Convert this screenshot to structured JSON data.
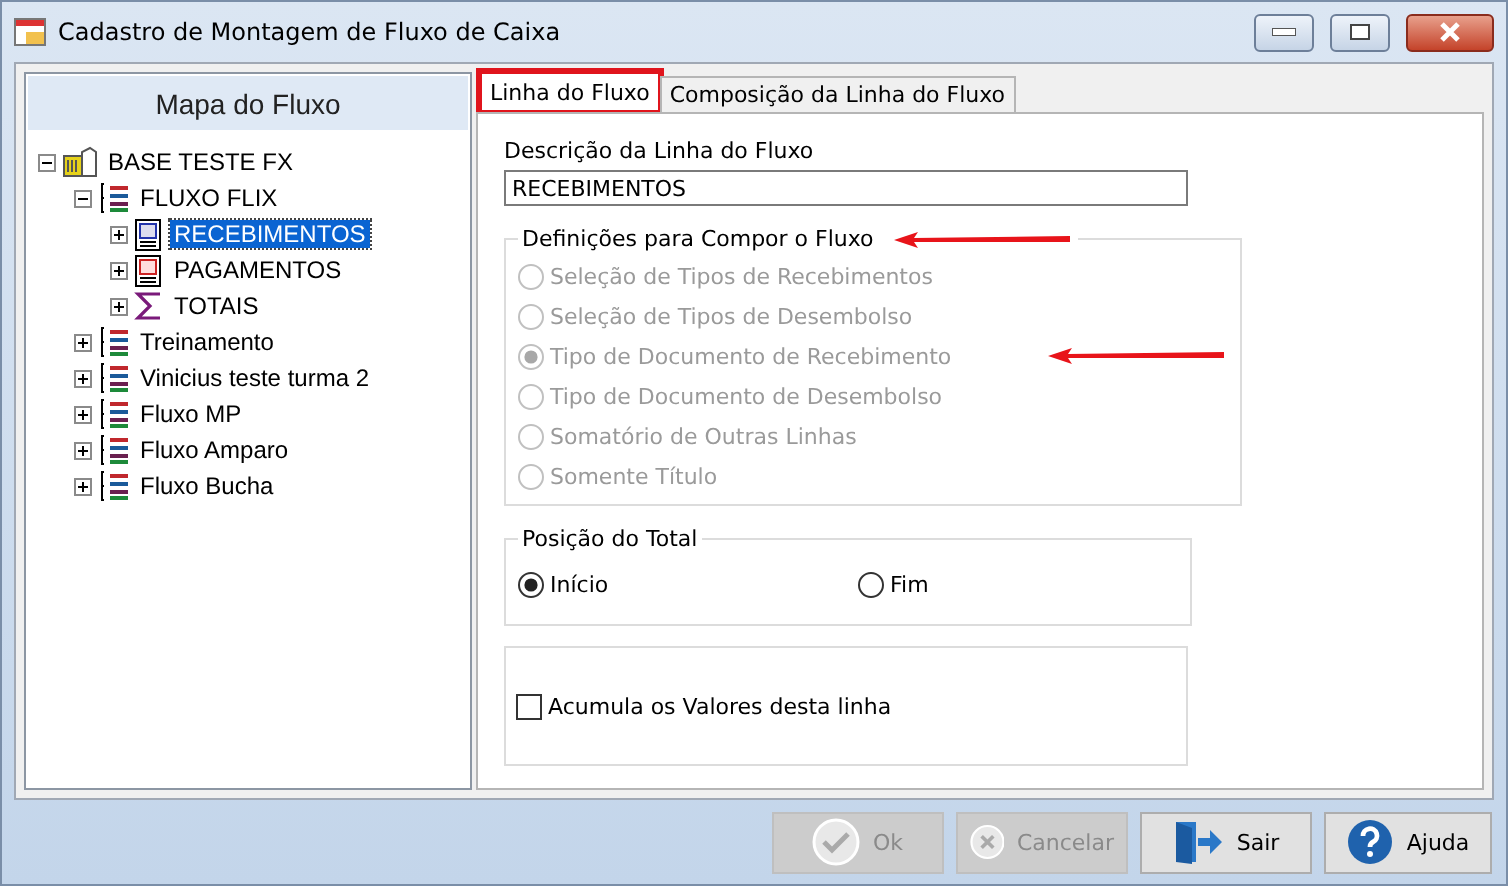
{
  "window": {
    "title": "Cadastro de Montagem de Fluxo de Caixa"
  },
  "tree_panel": {
    "title": "Mapa do Fluxo",
    "items": [
      {
        "label": "BASE TESTE FX",
        "kind": "building",
        "expanded": true,
        "selected": false,
        "children": [
          {
            "label": "FLUXO FLIX",
            "kind": "flow",
            "expanded": true,
            "selected": false,
            "children": [
              {
                "label": "RECEBIMENTOS",
                "kind": "doc-c",
                "expanded": false,
                "selected": true
              },
              {
                "label": "PAGAMENTOS",
                "kind": "doc-p",
                "expanded": false,
                "selected": false
              },
              {
                "label": "TOTAIS",
                "kind": "sigma",
                "expanded": false,
                "selected": false
              }
            ]
          },
          {
            "label": "Treinamento",
            "kind": "flow",
            "expanded": false,
            "selected": false
          },
          {
            "label": "Vinicius teste turma 2",
            "kind": "flow",
            "expanded": false,
            "selected": false
          },
          {
            "label": "Fluxo MP",
            "kind": "flow",
            "expanded": false,
            "selected": false
          },
          {
            "label": "Fluxo Amparo",
            "kind": "flow",
            "expanded": false,
            "selected": false
          },
          {
            "label": "Fluxo Bucha",
            "kind": "flow",
            "expanded": false,
            "selected": false
          }
        ]
      }
    ]
  },
  "tabs": [
    {
      "label": "Linha do Fluxo",
      "selected": true,
      "annotated": true
    },
    {
      "label": "Composição da Linha do Fluxo",
      "selected": false,
      "annotated": false
    }
  ],
  "description": {
    "label": "Descrição da Linha do Fluxo",
    "value": "RECEBIMENTOS"
  },
  "definitions": {
    "title": "Definições para Compor o Fluxo",
    "annotated": true,
    "disabled": true,
    "options": [
      {
        "label": "Seleção de Tipos de Recebimentos",
        "selected": false,
        "annotated": false
      },
      {
        "label": "Seleção de Tipos de Desembolso",
        "selected": false,
        "annotated": false
      },
      {
        "label": "Tipo de Documento de Recebimento",
        "selected": true,
        "annotated": true
      },
      {
        "label": "Tipo de Documento de Desembolso",
        "selected": false,
        "annotated": false
      },
      {
        "label": "Somatório de Outras Linhas",
        "selected": false,
        "annotated": false
      },
      {
        "label": "Somente Título",
        "selected": false,
        "annotated": false
      }
    ]
  },
  "total_position": {
    "title": "Posição do Total",
    "options": [
      {
        "label": "Início",
        "selected": true
      },
      {
        "label": "Fim",
        "selected": false
      }
    ]
  },
  "accumulate": {
    "label": "Acumula os Valores desta linha",
    "checked": false
  },
  "buttons": [
    {
      "label": "Ok",
      "kind": "check",
      "disabled": true
    },
    {
      "label": "Cancelar",
      "kind": "cross",
      "disabled": true
    },
    {
      "label": "Sair",
      "kind": "exit",
      "disabled": false
    },
    {
      "label": "Ajuda",
      "kind": "help",
      "disabled": false
    }
  ]
}
